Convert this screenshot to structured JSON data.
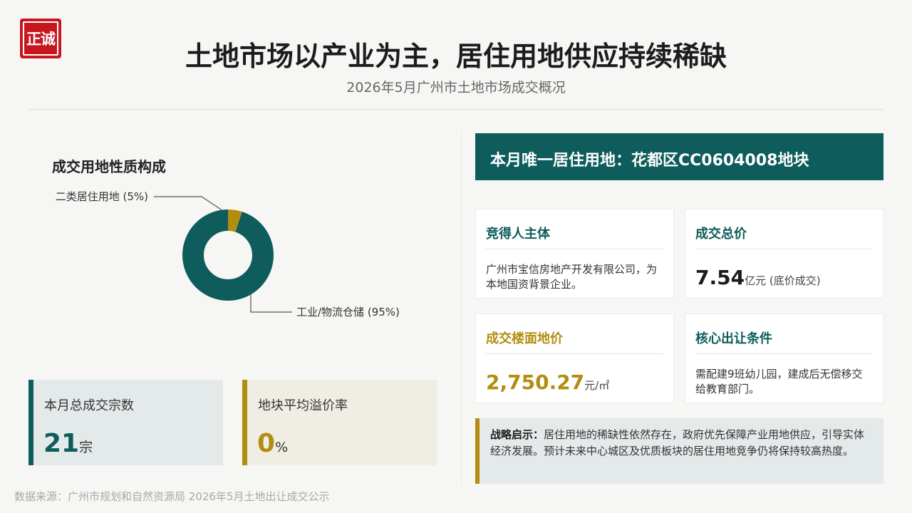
{
  "logo_text": "正诚",
  "title": "土地市场以产业为主，居住用地供应持续稀缺",
  "subtitle": "2026年5月广州市土地市场成交概况",
  "chart_data": {
    "type": "pie",
    "title": "成交用地性质构成",
    "categories": [
      "二类居住用地 (5%)",
      "工业/物流仓储 (95%)"
    ],
    "values": [
      5,
      95
    ],
    "colors": [
      "#b38d10",
      "#0e5c5b"
    ],
    "donut": true,
    "legend": "callout-labels"
  },
  "stats": [
    {
      "label": "本月总成交宗数",
      "value": "21",
      "unit": "宗"
    },
    {
      "label": "地块平均溢价率",
      "value": "0",
      "unit": "%"
    }
  ],
  "banner": "本月唯一居住用地：花都区CC0604008地块",
  "cards": {
    "bidder": {
      "head": "竞得人主体",
      "text": "广州市宝信房地产开发有限公司，为本地国资背景企业。"
    },
    "price": {
      "head": "成交总价",
      "value": "7.54",
      "unit": "亿元 (底价成交)"
    },
    "floor_price": {
      "head": "成交楼面地价",
      "value": "2,750.27",
      "unit": "元/㎡"
    },
    "conditions": {
      "head": "核心出让条件",
      "text": "需配建9班幼儿园，建成后无偿移交给教育部门。"
    }
  },
  "insight": {
    "label": "战略启示：",
    "text": "居住用地的稀缺性依然存在，政府优先保障产业用地供应，引导实体经济发展。预计未来中心城区及优质板块的居住用地竞争仍将保持较高热度。"
  },
  "source": "数据来源：广州市规划和自然资源局 2026年5月土地出让成交公示"
}
